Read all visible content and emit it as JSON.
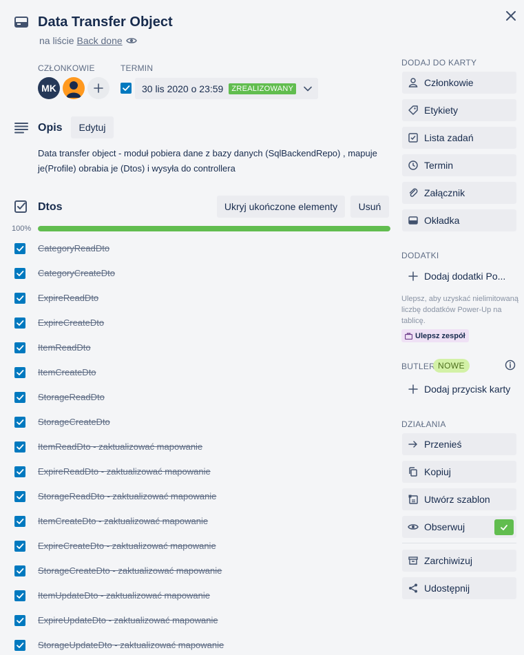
{
  "card": {
    "title": "Data Transfer Object",
    "list_prefix": "na liście",
    "list_name": "Back done"
  },
  "members": {
    "label": "CZŁONKOWIE",
    "initials": "MK"
  },
  "due": {
    "label": "TERMIN",
    "date": "30 lis 2020 o 23:59",
    "status": "ZREALIZOWANY",
    "checked": true
  },
  "description": {
    "title": "Opis",
    "edit_label": "Edytuj",
    "text": "Data transfer object - moduł pobiera dane z bazy danych (SqlBackendRepo) , mapuje je(Profile) obrabia je (Dtos) i wysyła do controllera"
  },
  "checklist": {
    "title": "Dtos",
    "hide_label": "Ukryj ukończone elementy",
    "delete_label": "Usuń",
    "progress_text": "100%",
    "progress_value": 1.0,
    "items": [
      "CategoryReadDto",
      "CategoryCreateDto",
      "ExpireReadDto",
      "ExpireCreateDto",
      "ItemReadDto",
      "ItemCreateDto",
      "StorageReadDto",
      "StorageCreateDto",
      "ItemReadDto - zaktualizować mapowanie",
      "ExpireReadDto - zaktualizować mapowanie",
      "StorageReadDto - zaktualizować mapowanie",
      "ItemCreateDto - zaktualizować mapowanie",
      "ExpireCreateDto - zaktualizować mapowanie",
      "StorageCreateDto - zaktualizować mapowanie",
      "ItemUpdateDto - zaktualizować mapowanie",
      "ExpireUpdateDto - zaktualizować mapowanie",
      "StorageUpdateDto - zaktualizować mapowanie"
    ]
  },
  "sidebar": {
    "add_label": "DODAJ DO KARTY",
    "add_items": [
      "Członkowie",
      "Etykiety",
      "Lista zadań",
      "Termin",
      "Załącznik",
      "Okładka"
    ],
    "powerups_label": "DODATKI",
    "add_powerups": "Dodaj dodatki Po...",
    "upsell_text": "Ulepsz, aby uzyskać nielimitowaną liczbę dodatków Power-Up na tablicę.",
    "upgrade_label": "Ulepsz zespół",
    "butler_label": "BUTLER",
    "new_badge": "NOWE",
    "add_card_button": "Dodaj przycisk karty",
    "actions_label": "DZIAŁANIA",
    "actions": [
      "Przenieś",
      "Kopiuj",
      "Utwórz szablon",
      "Obserwuj"
    ],
    "actions_bottom": [
      "Zarchiwizuj",
      "Udostępnij"
    ]
  },
  "colors": {
    "accent_blue": "#0079bf",
    "success_green": "#61bd4f",
    "title_text": "#172b4d",
    "muted_text": "#5e6c84"
  }
}
